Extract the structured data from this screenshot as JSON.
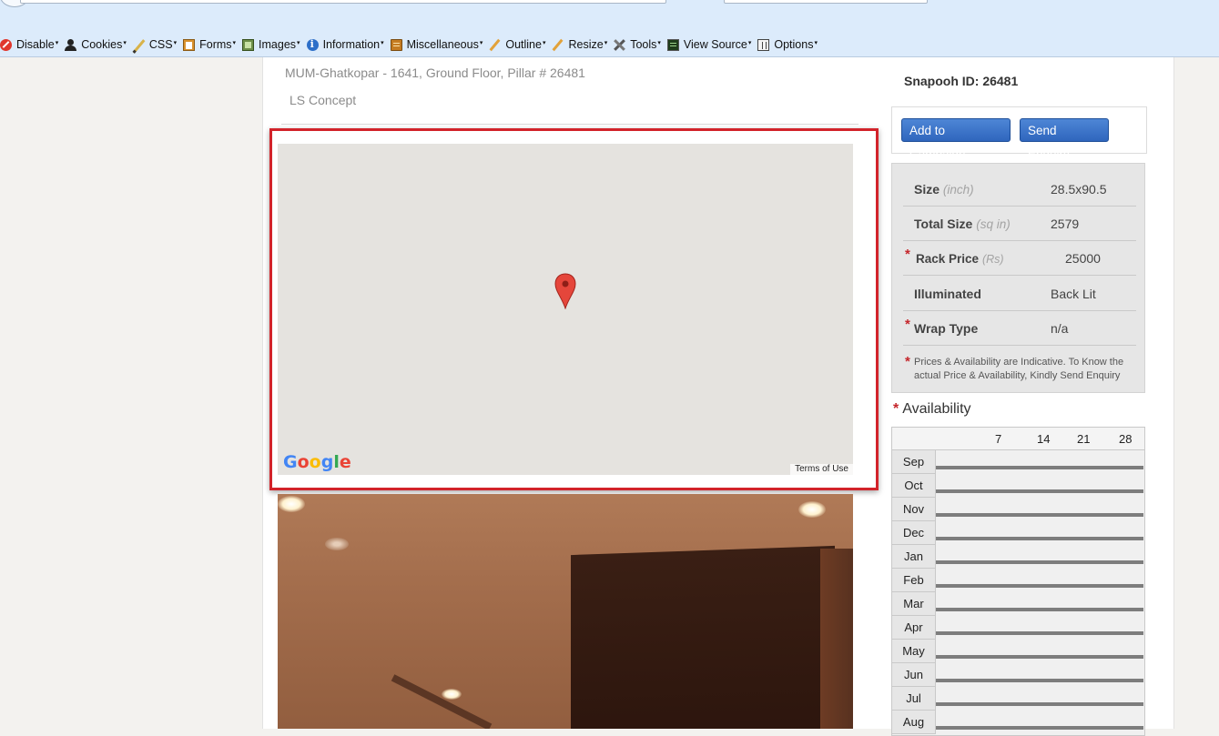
{
  "toolbar": {
    "items": [
      {
        "label": "Disable",
        "icon": "disable-icon"
      },
      {
        "label": "Cookies",
        "icon": "cookies-icon"
      },
      {
        "label": "CSS",
        "icon": "css-icon"
      },
      {
        "label": "Forms",
        "icon": "forms-icon"
      },
      {
        "label": "Images",
        "icon": "images-icon"
      },
      {
        "label": "Information",
        "icon": "information-icon"
      },
      {
        "label": "Miscellaneous",
        "icon": "miscellaneous-icon"
      },
      {
        "label": "Outline",
        "icon": "outline-icon"
      },
      {
        "label": "Resize",
        "icon": "resize-icon"
      },
      {
        "label": "Tools",
        "icon": "tools-icon"
      },
      {
        "label": "View Source",
        "icon": "view-source-icon"
      },
      {
        "label": "Options",
        "icon": "options-icon"
      }
    ]
  },
  "listing": {
    "location": "MUM-Ghatkopar - 1641, Ground Floor, Pillar # 26481",
    "brand": "LS Concept"
  },
  "map": {
    "logo": [
      "G",
      "o",
      "o",
      "g",
      "l",
      "e"
    ],
    "terms": "Terms of Use",
    "pin_icon": "map-pin-icon"
  },
  "sidebar": {
    "snapooh_id": "Snapooh ID: 26481",
    "add_campaign": "Add to Campaign",
    "send_enquiry": "Send Enquiry",
    "specs": {
      "size_label": "Size",
      "size_unit": "(inch)",
      "size_value": "28.5x90.5",
      "total_label": "Total Size",
      "total_unit": "(sq in)",
      "total_value": "2579",
      "rack_label": "Rack Price",
      "rack_unit": "(Rs)",
      "rack_value": "25000",
      "illum_label": "Illuminated",
      "illum_value": "Back Lit",
      "wrap_label": "Wrap Type",
      "wrap_value": "n/a",
      "required_mark": "*",
      "note": "Prices & Availability are Indicative. To Know the actual Price & Availability, Kindly Send Enquiry"
    },
    "availability": {
      "title": "Availability",
      "days": [
        "7",
        "14",
        "21",
        "28"
      ],
      "months": [
        "Sep",
        "Oct",
        "Nov",
        "Dec",
        "Jan",
        "Feb",
        "Mar",
        "Apr",
        "May",
        "Jun",
        "Jul",
        "Aug"
      ]
    }
  },
  "colors": {
    "highlight_border": "#d2232a",
    "button_blue": "#2f66bd",
    "required_red": "#c5262b",
    "chrome_bg": "#dcebfb"
  }
}
